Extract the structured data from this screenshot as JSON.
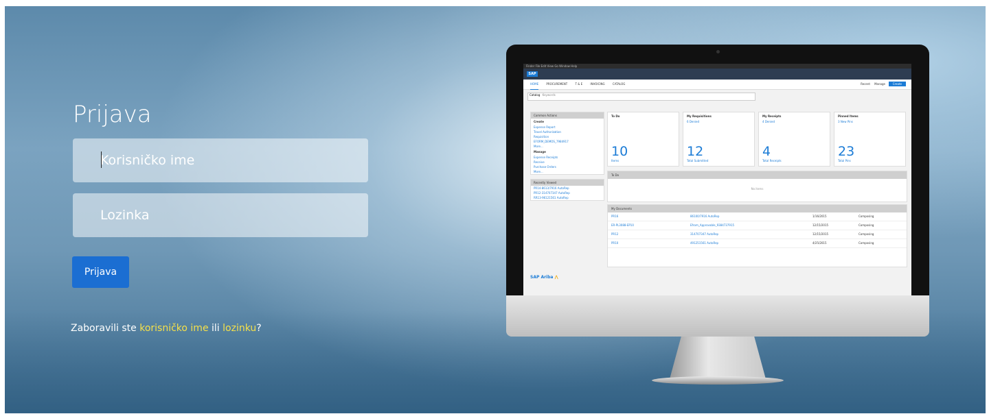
{
  "login": {
    "title": "Prijava",
    "username_placeholder": "Korisničko ime",
    "password_placeholder": "Lozinka",
    "submit_label": "Prijava",
    "forgot_prefix": "Zaboravili ste ",
    "forgot_username_link": "korisničko ime",
    "forgot_middle": " ili ",
    "forgot_password_link": "lozinku",
    "forgot_suffix": "?"
  },
  "colors": {
    "button": "#1b6ed2",
    "link": "#f5e04a",
    "background": "#6f98b6"
  },
  "monitor_screen": {
    "mac_menu": "Finder  File  Edit  View  Go  Window  Help",
    "tabs": [
      "HOME",
      "PROCUREMENT",
      "T & E",
      "INVOICING",
      "CATALOG"
    ],
    "right_menu": [
      "Recent",
      "Manage"
    ],
    "create_label": "Create",
    "search_scope": "Catalog",
    "search_placeholder": "Keywords",
    "common_actions": {
      "title": "Common Actions",
      "create_heading": "Create",
      "create_links": [
        "Expense Report",
        "Travel Authorization",
        "Requisition",
        "EFORM_DEMOS_7984917",
        "More..."
      ],
      "manage_heading": "Manage",
      "manage_links": [
        "Expense Receipts",
        "Receive",
        "Purchase Orders",
        "More..."
      ]
    },
    "recently_viewed": {
      "title": "Recently Viewed",
      "links": [
        "PR14-8613/7916 AutoRep",
        "PR12-314707347 AutoRep",
        "RR13-96121561 AutoRep"
      ]
    },
    "cards": [
      {
        "title": "To Do",
        "subtitle": "",
        "number": "10",
        "caption": "Items"
      },
      {
        "title": "My Requisitions",
        "subtitle": "6 Denied",
        "number": "12",
        "caption": "Total Submitted"
      },
      {
        "title": "My Receipts",
        "subtitle": "4 Denied",
        "number": "4",
        "caption": "Total Receipts"
      },
      {
        "title": "Pinned Items",
        "subtitle": "3 New Pins",
        "number": "23",
        "caption": "Total Pins"
      }
    ],
    "todo_title": "To Do",
    "todo_empty": "No items",
    "docs_title": "My Documents",
    "documents": [
      {
        "id": "PR16",
        "title": "86100/7916 AutoRep",
        "date": "1/16/2015",
        "status": "Composing"
      },
      {
        "id": "ER-PL3088-EP10",
        "title": "Efrom_Approvable_9384737915",
        "date": "12/15/2015",
        "status": "Composing"
      },
      {
        "id": "PR12",
        "title": "314707347 AutoRep",
        "date": "12/15/2015",
        "status": "Composing"
      },
      {
        "id": "PR10",
        "title": "491251561 AutoRep",
        "date": "4/25/2015",
        "status": "Composing"
      }
    ],
    "footer_brand": "SAP Ariba"
  }
}
